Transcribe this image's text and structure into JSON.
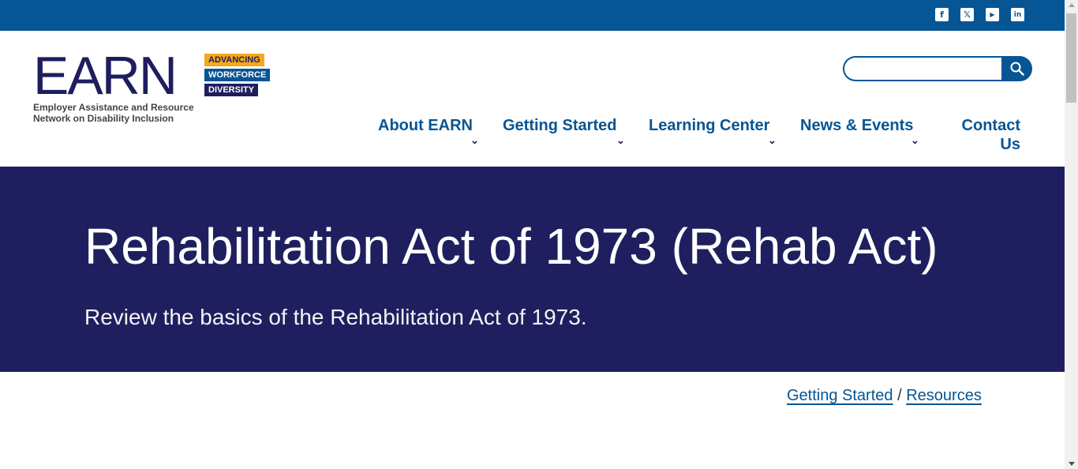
{
  "social": [
    {
      "icon": "facebook-icon",
      "glyph": "f"
    },
    {
      "icon": "x-twitter-icon",
      "glyph": "𝕏"
    },
    {
      "icon": "youtube-icon",
      "glyph": "▶"
    },
    {
      "icon": "linkedin-icon",
      "glyph": "in"
    }
  ],
  "logo": {
    "word": "EARN",
    "tags": [
      "ADVANCING",
      "WORKFORCE",
      "DIVERSITY"
    ],
    "subtitle_line1": "Employer Assistance and Resource",
    "subtitle_line2": "Network on Disability Inclusion"
  },
  "search": {
    "placeholder": "",
    "value": "",
    "icon": "search-icon"
  },
  "nav": {
    "items": [
      {
        "label": "About EARN"
      },
      {
        "label": "Getting Started"
      },
      {
        "label": "Learning Center"
      },
      {
        "label": "News & Events"
      },
      {
        "label": "Contact Us"
      }
    ]
  },
  "hero": {
    "title": "Rehabilitation Act of 1973 (Rehab Act)",
    "subtitle": "Review the basics of the Rehabilitation Act of 1973."
  },
  "breadcrumb": {
    "items": [
      "Getting Started",
      "Resources"
    ],
    "separator": "/"
  },
  "colors": {
    "topbar": "#065594",
    "hero": "#1f1f5f",
    "nav_text": "#065594",
    "tag_gold": "#f4a81c"
  }
}
